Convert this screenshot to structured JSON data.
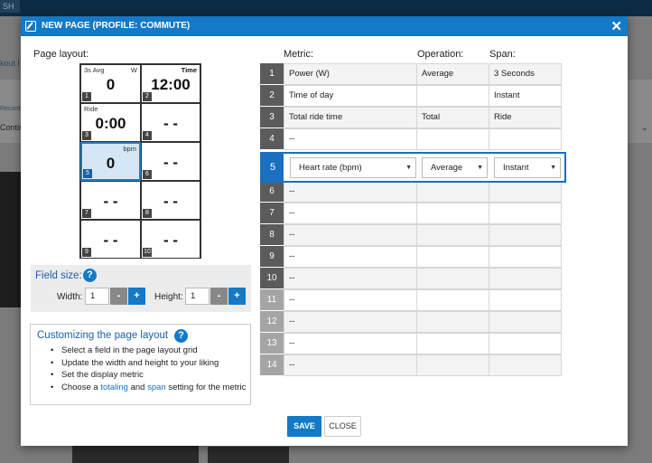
{
  "background": {
    "tab_text": "SH",
    "left_link1": "kout l",
    "left_link2": "Record",
    "left_text3": "Contin",
    "chevron": "⌄"
  },
  "modal": {
    "title": "NEW PAGE (PROFILE: COMMUTE)",
    "close_glyph": "✕"
  },
  "layout": {
    "label": "Page layout:",
    "cells": [
      {
        "num": "1",
        "top_left": "3s Avg",
        "top_right": "W",
        "value": "0"
      },
      {
        "num": "2",
        "top_left": "",
        "top_right": "Time",
        "value": "12:00"
      },
      {
        "num": "3",
        "top_left": "Ride",
        "top_right": "",
        "value": "0:00"
      },
      {
        "num": "4",
        "top_left": "",
        "top_right": "",
        "value": "- -"
      },
      {
        "num": "5",
        "top_left": "",
        "top_right": "bpm",
        "value": "0"
      },
      {
        "num": "6",
        "top_left": "",
        "top_right": "",
        "value": "- -"
      },
      {
        "num": "7",
        "top_left": "",
        "top_right": "",
        "value": "- -"
      },
      {
        "num": "8",
        "top_left": "",
        "top_right": "",
        "value": "- -"
      },
      {
        "num": "9",
        "top_left": "",
        "top_right": "",
        "value": "- -"
      },
      {
        "num": "10",
        "top_left": "",
        "top_right": "",
        "value": "- -"
      }
    ]
  },
  "field_size": {
    "title": "Field size:",
    "help": "?",
    "width_label": "Width:",
    "width_value": "1",
    "height_label": "Height:",
    "height_value": "1",
    "minus": "-",
    "plus": "+"
  },
  "customize": {
    "title": "Customizing the page layout",
    "help": "?",
    "items": [
      "Select a field in the page layout grid",
      "Update the width and height to your liking",
      "Set the display metric"
    ],
    "last_prefix": "Choose a ",
    "last_link1": "totaling",
    "last_mid": " and ",
    "last_link2": "span",
    "last_suffix": " setting for the metric"
  },
  "table": {
    "headers": {
      "metric": "Metric:",
      "operation": "Operation:",
      "span": "Span:"
    },
    "rows": [
      {
        "num": "1",
        "metric": "Power (W)",
        "operation": "Average",
        "span": "3 Seconds"
      },
      {
        "num": "2",
        "metric": "Time of day",
        "operation": "",
        "span": "Instant"
      },
      {
        "num": "3",
        "metric": "Total ride time",
        "operation": "Total",
        "span": "Ride"
      },
      {
        "num": "4",
        "metric": "--",
        "operation": "",
        "span": ""
      },
      {
        "num": "6",
        "metric": "--",
        "operation": "",
        "span": ""
      },
      {
        "num": "7",
        "metric": "--",
        "operation": "",
        "span": ""
      },
      {
        "num": "8",
        "metric": "--",
        "operation": "",
        "span": ""
      },
      {
        "num": "9",
        "metric": "--",
        "operation": "",
        "span": ""
      },
      {
        "num": "10",
        "metric": "--",
        "operation": "",
        "span": ""
      },
      {
        "num": "11",
        "metric": "--",
        "operation": "",
        "span": ""
      },
      {
        "num": "12",
        "metric": "--",
        "operation": "",
        "span": ""
      },
      {
        "num": "13",
        "metric": "--",
        "operation": "",
        "span": ""
      },
      {
        "num": "14",
        "metric": "--",
        "operation": "",
        "span": ""
      }
    ],
    "selected": {
      "num": "5",
      "metric": "Heart rate (bpm)",
      "operation": "Average",
      "span": "Instant",
      "arrow": "▼"
    }
  },
  "buttons": {
    "save": "SAVE",
    "close": "CLOSE"
  }
}
